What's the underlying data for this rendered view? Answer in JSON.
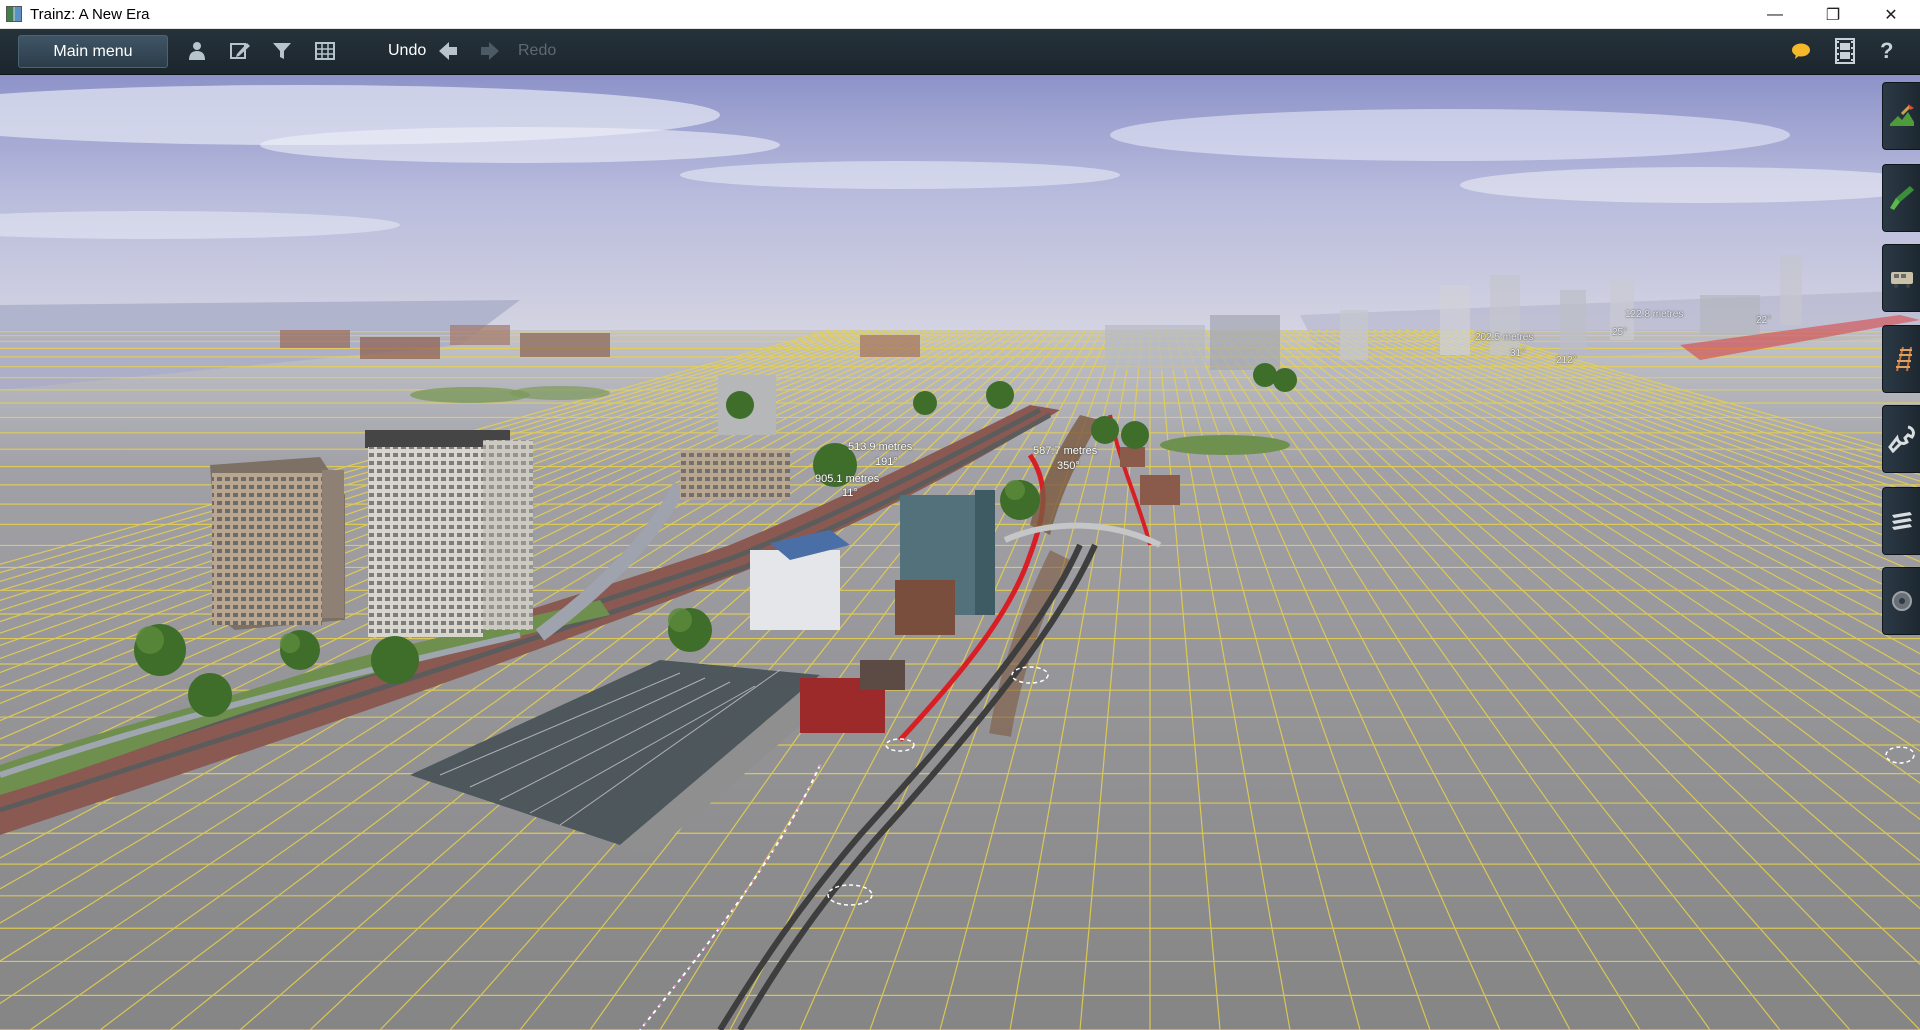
{
  "window": {
    "title": "Trainz: A New Era",
    "minimize": "—",
    "restore": "❐",
    "close": "✕"
  },
  "toolbar": {
    "main_menu_label": "Main menu",
    "undo_label": "Undo",
    "redo_label": "Redo",
    "icons": [
      "person-icon",
      "edit-icon",
      "filter-icon",
      "grid-icon",
      "undo-arrow-icon",
      "redo-arrow-icon",
      "chat-icon",
      "film-icon",
      "help-icon"
    ],
    "help_glyph": "?"
  },
  "colors": {
    "toolbar_bg": "#1f2a33",
    "grid_line": "#e8d24a",
    "ground": "#8d8d8d",
    "sky": "#b9bcd6",
    "red_track": "#d81f26"
  },
  "viewport": {
    "labels": [
      {
        "id": "l1",
        "text": "513.9 metres"
      },
      {
        "id": "l2",
        "text": "191°"
      },
      {
        "id": "l3",
        "text": "905.1 metres"
      },
      {
        "id": "l4",
        "text": "11°"
      },
      {
        "id": "l5",
        "text": "587.7 metres"
      },
      {
        "id": "l6",
        "text": "350°"
      },
      {
        "id": "l7",
        "text": "202.5 metres"
      },
      {
        "id": "l8",
        "text": "31°"
      },
      {
        "id": "l9",
        "text": "25°"
      },
      {
        "id": "l10",
        "text": "22°"
      },
      {
        "id": "l11",
        "text": "122.8 metres"
      },
      {
        "id": "l12",
        "text": "212°"
      }
    ]
  },
  "palette": {
    "tools": [
      "terrain-tool-icon",
      "paint-brush-icon",
      "train-car-icon",
      "track-tool-icon",
      "wrench-icon",
      "layers-icon",
      "gear-disc-icon"
    ]
  }
}
